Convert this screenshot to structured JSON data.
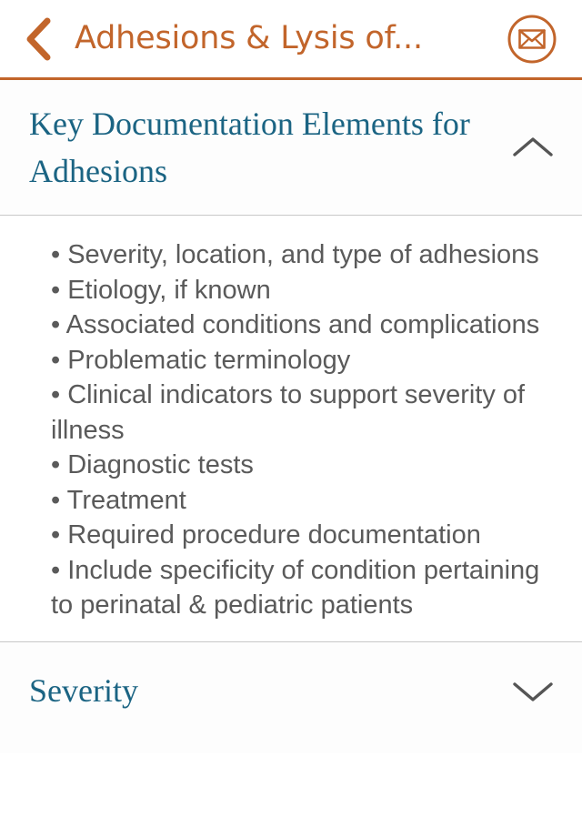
{
  "navbar": {
    "back_icon": "chevron-left-icon",
    "title": "Adhesions & Lysis of...",
    "mail_icon": "envelope-circle-icon",
    "accent_color": "#c2652b"
  },
  "sections": [
    {
      "title": "Key Documentation Elements for Adhesions",
      "expanded": true,
      "chevron_icon": "chevron-up-icon",
      "title_color": "#1b6483",
      "items": [
        "• Severity, location, and type of adhesions",
        "• Etiology, if known",
        "• Associated conditions and complications",
        "• Problematic terminology",
        "• Clinical indicators to support severity of illness",
        "• Diagnostic tests",
        "• Treatment",
        "• Required procedure documentation",
        "• Include specificity of condition pertaining to perinatal & pediatric patients"
      ]
    },
    {
      "title": "Severity",
      "expanded": false,
      "chevron_icon": "chevron-down-icon",
      "title_color": "#1b6483"
    }
  ]
}
